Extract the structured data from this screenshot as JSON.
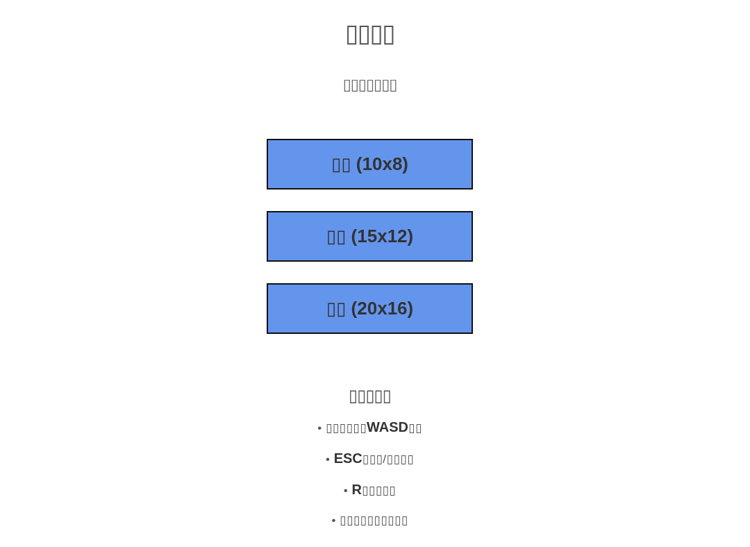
{
  "title": "▯▯▯▯",
  "subtitle": "▯▯▯▯▯▯▯",
  "difficulty_buttons": [
    {
      "label": "▯▯ (10x8)"
    },
    {
      "label": "▯▯ (15x12)"
    },
    {
      "label": "▯▯ (20x16)"
    }
  ],
  "controls": {
    "heading": "▯▯▯▯▯",
    "items": [
      "• ▯▯▯▯▯▯**WASD**▯▯",
      "• **ESC**▯▯▯/▯▯▯▯",
      "• **R**▯▯▯▯▯",
      "• ▯▯▯▯▯▯▯▯▯▯"
    ]
  }
}
